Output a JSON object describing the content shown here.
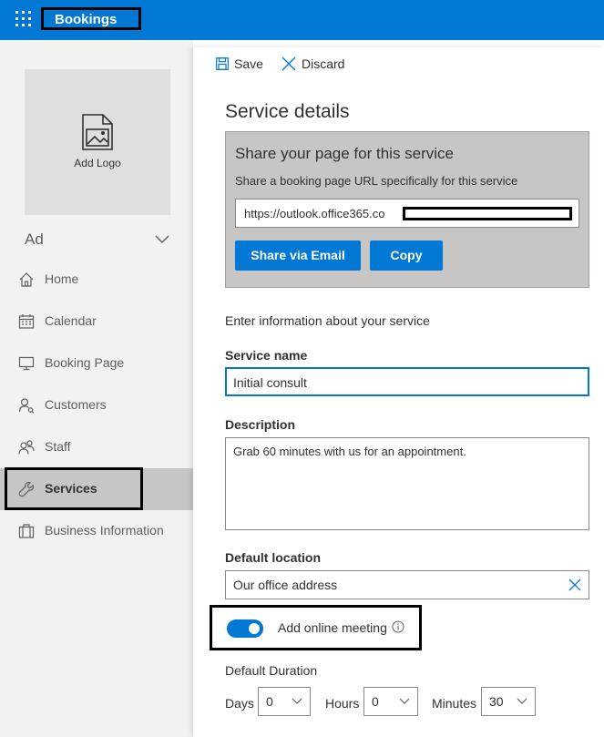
{
  "app": {
    "title": "Bookings"
  },
  "sidebar": {
    "logo_label": "Add Logo",
    "business_name": "Ad",
    "items": [
      {
        "label": "Home",
        "icon": "home-icon",
        "selected": false
      },
      {
        "label": "Calendar",
        "icon": "calendar-icon",
        "selected": false
      },
      {
        "label": "Booking Page",
        "icon": "monitor-icon",
        "selected": false
      },
      {
        "label": "Customers",
        "icon": "person-icon",
        "selected": false
      },
      {
        "label": "Staff",
        "icon": "people-icon",
        "selected": false
      },
      {
        "label": "Services",
        "icon": "wrench-icon",
        "selected": true
      },
      {
        "label": "Business Information",
        "icon": "briefcase-icon",
        "selected": false
      }
    ]
  },
  "toolbar": {
    "save_label": "Save",
    "discard_label": "Discard"
  },
  "panel": {
    "title": "Service details",
    "share": {
      "title": "Share your page for this service",
      "subtitle": "Share a booking page URL specifically for this service",
      "url": "https://outlook.office365.co",
      "email_button": "Share via Email",
      "copy_button": "Copy"
    },
    "intro": "Enter information about your service",
    "service_name": {
      "label": "Service name",
      "value": "Initial consult"
    },
    "description": {
      "label": "Description",
      "value": "Grab 60 minutes with us for an appointment."
    },
    "location": {
      "label": "Default location",
      "value": "Our office address"
    },
    "online_meeting": {
      "label": "Add online meeting",
      "enabled": true
    },
    "duration": {
      "label": "Default Duration",
      "days_label": "Days",
      "days_value": "0",
      "hours_label": "Hours",
      "hours_value": "0",
      "minutes_label": "Minutes",
      "minutes_value": "30"
    }
  },
  "colors": {
    "accent": "#0078d4",
    "selected_nav": "#c8c6c4",
    "sidebar_bg": "#f3f2f1"
  }
}
